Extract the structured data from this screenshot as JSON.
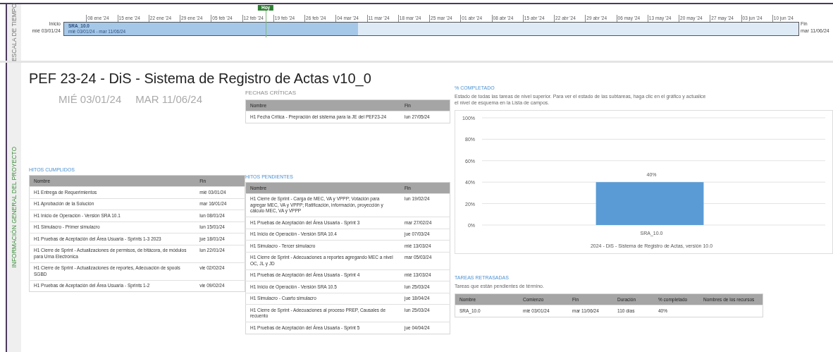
{
  "timescale": {
    "label": "ESCALA DE TIEMPO",
    "start": {
      "label": "Inicio",
      "date": "mié 03/01/24"
    },
    "end": {
      "label": "Fin",
      "date": "mar 11/06/24"
    },
    "ticks": [
      "08 ene '24",
      "15 ene '24",
      "22 ene '24",
      "29 ene '24",
      "05 feb '24",
      "12 feb '24",
      "19 feb '24",
      "26 feb '24",
      "04 mar '24",
      "11 mar '24",
      "18 mar '24",
      "25 mar '24",
      "01 abr '24",
      "08 abr '24",
      "15 abr '24",
      "22 abr '24",
      "29 abr '24",
      "06 may '24",
      "13 may '24",
      "20 may '24",
      "27 may '24",
      "03 jun '24",
      "10 jun '24"
    ],
    "today": {
      "label": "Hoy",
      "level": 0.275
    },
    "task": {
      "name": "SRA_10.0",
      "dates": "mié 03/01/24 - mar 11/06/24",
      "level": 0.4
    }
  },
  "side_label": "INFORMACIÓN GENERAL DEL PROYECTO",
  "title": "PEF 23-24 - DiS - Sistema de Registro de Actas v10_0",
  "dates": [
    "MIÉ 03/01/24",
    "MAR 11/06/24"
  ],
  "completed_milestones": {
    "heading": "HITOS CUMPLIDOS",
    "columns": [
      "Nombre",
      "Fin"
    ],
    "rows": [
      [
        "H1 Entrega de Requerimientos",
        "mié 03/01/24"
      ],
      [
        "H1 Aprobación de la Solución",
        "mar 16/01/24"
      ],
      [
        "H1 Inicio de Operación - Versión SRA 10.1",
        "lun 08/01/24"
      ],
      [
        "H1 Simulacro - Primer simulacro",
        "lun 15/01/24"
      ],
      [
        "H1 Pruebas de Aceptación del Área Usuaria - Sprints 1-3 2023",
        "jue 18/01/24"
      ],
      [
        "H1 Cierre de Sprint - Actualizaciones de permisos, de bitácora, de módulos para Urna Electrónica",
        "lun 22/01/24"
      ],
      [
        "H1 Cierre de Sprint - Actualizaciones de reportes, Adecuación de spools SGBD",
        "vie 02/02/24"
      ],
      [
        "H1 Pruebas de Aceptación del Área Usuaria - Sprints 1-2",
        "vie 09/02/24"
      ]
    ]
  },
  "critical_dates": {
    "heading": "FECHAS CRÍTICAS",
    "columns": [
      "Nombre",
      "Fin"
    ],
    "rows": [
      [
        "H1 Fecha Crítica - Prepración del sistema para la JE del PEF23-24",
        "lun 27/05/24"
      ]
    ]
  },
  "pending_milestones": {
    "heading": "HITOS PENDIENTES",
    "columns": [
      "Nombre",
      "Fin"
    ],
    "rows": [
      [
        "H1 Cierre de Sprint - Carga de MEC, VA y VPPP; Votación para agregar MEC, VA y VPPP; Ratificación, información, proyección y cálculo MEC, VA y VPPP",
        "lun 19/02/24"
      ],
      [
        "H1 Pruebas de Aceptación del Área Usuaria - Sprint 3",
        "mar 27/02/24"
      ],
      [
        "H1 Inicio de Operación - Versión SRA 10.4",
        "jue 07/03/24"
      ],
      [
        "H1 Simulacro - Tercer simulacro",
        "mié 13/03/24"
      ],
      [
        "H1 Cierre de Sprint - Adecuaciones a reportes agregando MEC a nivel OC, JL y JD",
        "mar 05/03/24"
      ],
      [
        "H1 Pruebas de Aceptación del Área Usuaria - Sprint 4",
        "mié 13/03/24"
      ],
      [
        "H1 Inicio de Operación - Versión SRA 10.5",
        "lun 25/03/24"
      ],
      [
        "H1 Simulacro - Cuarto simulacro",
        "jue 18/04/24"
      ],
      [
        "H1 Cierre de Sprint - Adecuaciones al proceso PREP, Causales de recuento",
        "lun 25/03/24"
      ],
      [
        "H1 Pruebas de Aceptación del Área Usuaria - Sprint 5",
        "jue 04/04/24"
      ]
    ]
  },
  "percent_complete": {
    "heading": "% COMPLETADO",
    "description": "Estado de todas las tareas de nivel superior. Para ver el estado de las subtareas, haga clic en el gráfico y actualice el nivel de esquema en la Lista de campos.",
    "chart_data": {
      "type": "bar",
      "xlabel": "2024 - DiS - Sistema de Registro de Actas, versión 10.0",
      "categories": [
        "SRA_10.0"
      ],
      "values": [
        40
      ],
      "grid": true,
      "ylim": [
        0,
        100
      ],
      "yticks": [
        {
          "value": 0,
          "label": "0%"
        },
        {
          "value": 20,
          "label": "20%"
        },
        {
          "value": 40,
          "label": "40%"
        },
        {
          "value": 60,
          "label": "60%"
        },
        {
          "value": 80,
          "label": "80%"
        },
        {
          "value": 100,
          "label": "100%"
        }
      ],
      "value_labels": [
        "40%"
      ]
    }
  },
  "late_tasks": {
    "heading": "TAREAS RETRASADAS",
    "description": "Tareas que están pendientes de término.",
    "columns": [
      "Nombre",
      "Comienzo",
      "Fin",
      "Duración",
      "% completado",
      "Nombres de los recursos"
    ],
    "rows": [
      [
        "SRA_10.0",
        "mié 03/01/24",
        "mar 11/06/24",
        "110 días",
        "40%"
      ]
    ]
  }
}
